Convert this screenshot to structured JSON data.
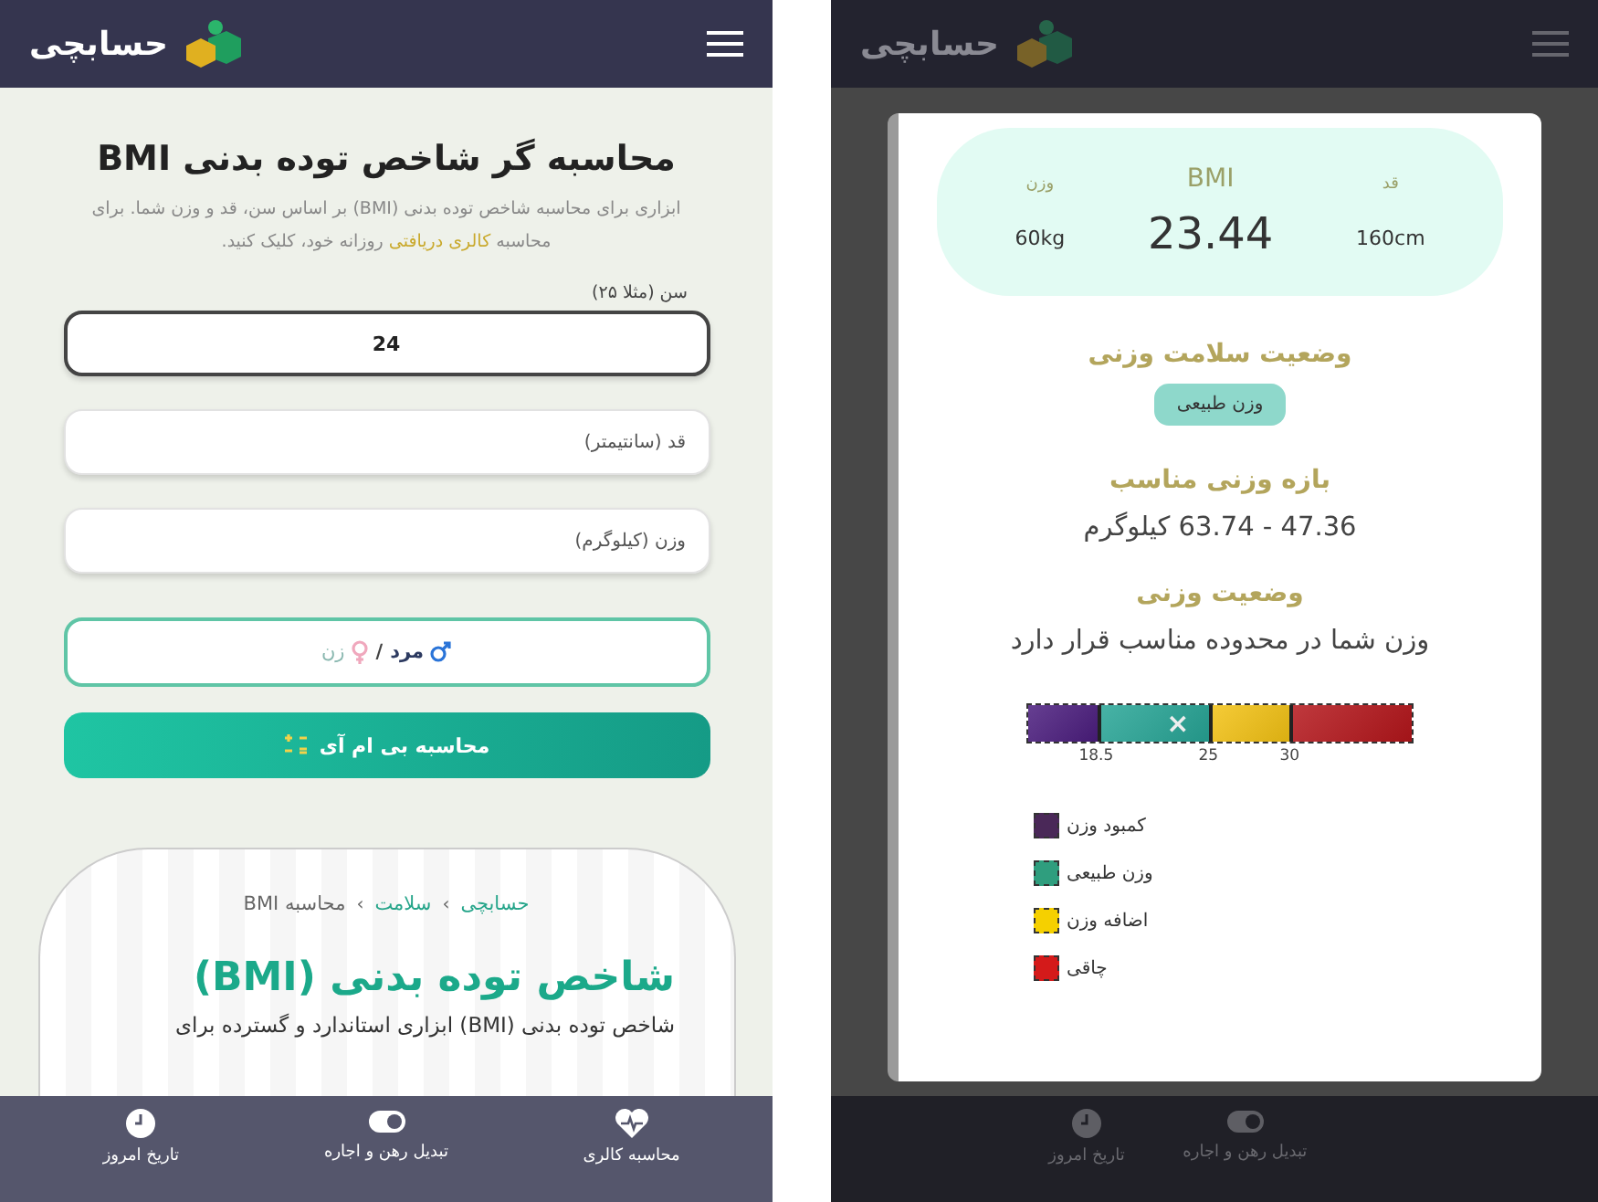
{
  "calculator_screen": {
    "logo": "حسابچی",
    "title": "محاسبه گر شاخص توده بدنی BMI",
    "description": {
      "before": "ابزاری برای محاسبه شاخص توده بدنی (BMI) بر اساس سن، قد و وزن شما. برای محاسبه",
      "link": "کالری دریافتی",
      "after": "روزانه خود، کلیک کنید."
    },
    "fields": [
      {
        "label": "سن (مثلا ۲۵)",
        "value": "24",
        "focused": true
      },
      {
        "placeholder": "قد (سانتیمتر)",
        "focused": false
      },
      {
        "placeholder": "وزن (کیلوگرم)",
        "focused": false
      }
    ],
    "gender": {
      "separator": "/",
      "options": [
        {
          "kind": "male",
          "label": "مرد",
          "selected": true
        },
        {
          "kind": "female",
          "label": "زن",
          "selected": false
        }
      ]
    },
    "calculate_button": "محاسبه بی ام آی",
    "card": {
      "breadcrumb": [
        {
          "label": "حسابچی",
          "current": false
        },
        {
          "label": "سلامت",
          "current": false
        },
        {
          "label": "محاسبه BMI",
          "current": true
        }
      ],
      "separator": "›",
      "heading": "شاخص توده بدنی (BMI)",
      "paragraph": "شاخص توده بدنی (BMI) ابزاری استاندارد و گسترده برای"
    },
    "nav": [
      {
        "kind": "heart",
        "label": "محاسبه کالری"
      },
      {
        "kind": "toggle",
        "label": "تبدیل رهن و اجاره"
      },
      {
        "kind": "clock",
        "label": "تاریخ امروز"
      }
    ]
  },
  "result_screen": {
    "logo": "حسابچی",
    "summary": [
      {
        "kind": "side",
        "label": "قد",
        "value": "160cm"
      },
      {
        "kind": "main",
        "label": "BMI",
        "value": "23.44"
      },
      {
        "kind": "side",
        "label": "وزن",
        "value": "60kg"
      }
    ],
    "status_heading": "وضعیت سلامت وزنی",
    "status_badge": "وزن طبیعی",
    "range_heading": "بازه وزنی مناسب",
    "range_value": "47.36 - 63.74 کیلوگرم",
    "weight_heading": "وضعیت وزنی",
    "weight_message": "وزن شما در محدوده مناسب قرار دارد",
    "scale": {
      "segments": [
        {
          "color": "#b4161b"
        },
        {
          "color": "#f3c214"
        },
        {
          "color": "#27a596"
        },
        {
          "color": "#4b1d7e"
        }
      ],
      "ticks": [
        "30",
        "25",
        "18.5"
      ],
      "marker": {
        "symbol": "×",
        "level": 0.39
      }
    },
    "legend": [
      {
        "label": "کمبود وزن",
        "color": "#4a2858"
      },
      {
        "label": "وزن طبیعی",
        "color": "#2f9e7e"
      },
      {
        "label": "اضافه وزن",
        "color": "#f5d000"
      },
      {
        "label": "چاقی",
        "color": "#d41a1a"
      }
    ],
    "nav": [
      {
        "kind": "toggle",
        "label": "تبدیل رهن و اجاره"
      },
      {
        "kind": "clock",
        "label": "تاریخ امروز"
      }
    ]
  }
}
